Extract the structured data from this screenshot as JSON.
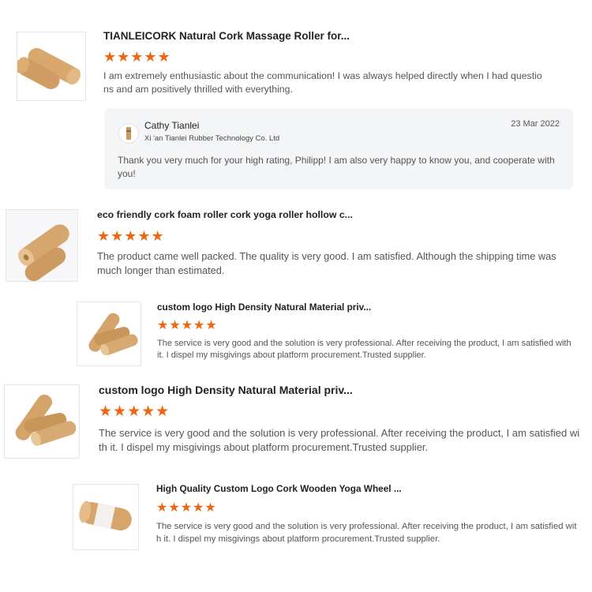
{
  "reviews": [
    {
      "product_title": "TIANLEICORK Natural Cork Massage Roller for...",
      "stars": "★★★★★",
      "rating": 5,
      "text": "I am extremely enthusiastic about the communication! I was always helped directly when I had questions and am positively thrilled with everything.",
      "thumb_icon": "cork-roller-image",
      "reply": {
        "author": "Cathy Tianlei",
        "company": "Xi 'an Tianlei Rubber Technology Co. Ltd",
        "date": "23 Mar 2022",
        "message": "Thank you very much for your high rating, Philipp!  I am also very happy to know you, and cooperate with you!"
      }
    },
    {
      "product_title": "eco friendly cork foam roller cork yoga roller hollow c...",
      "stars": "★★★★★",
      "rating": 5,
      "text": "The product came well packed. The quality is very good. I am satisfied. Although the shipping time was much longer than estimated.",
      "thumb_icon": "cork-roller-image"
    },
    {
      "product_title": "custom logo High Density Natural Material priv...",
      "stars": "★★★★★",
      "rating": 5,
      "text": "The service is very good and the solution is very professional. After receiving the product, I am satisfied with it. I dispel my misgivings about platform procurement.Trusted supplier.",
      "thumb_icon": "cork-rollers-image"
    },
    {
      "product_title": "custom logo High Density Natural Material priv...",
      "stars": "★★★★★",
      "rating": 5,
      "text": "The service is very good and the solution is very professional. After receiving the product, I am satisfied with it. I dispel my misgivings about platform procurement.Trusted supplier.",
      "thumb_icon": "cork-rollers-image"
    },
    {
      "product_title": "High Quality Custom Logo Cork Wooden Yoga Wheel ...",
      "stars": "★★★★★",
      "rating": 5,
      "text": "The service is very good and the solution is very professional. After receiving the product, I am satisfied with it. I dispel my misgivings about platform procurement.Trusted supplier.",
      "thumb_icon": "cork-yoga-wheel-image"
    }
  ],
  "colors": {
    "star": "#f2640f",
    "reply_bg": "#f4f5f7",
    "cork": "#d4a471"
  }
}
